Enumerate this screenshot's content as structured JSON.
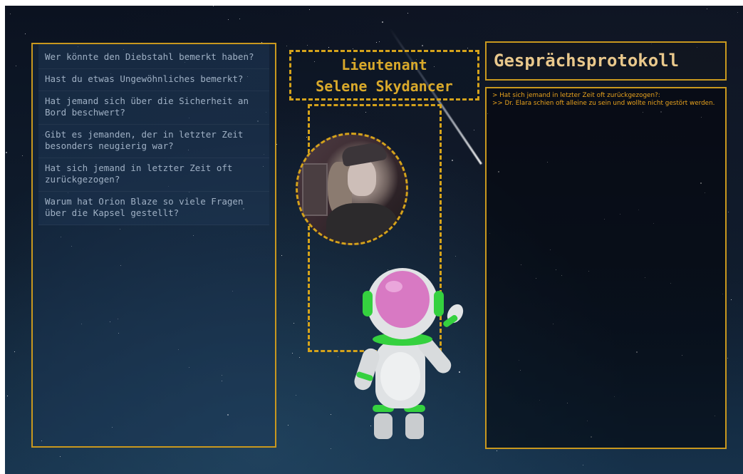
{
  "questions": [
    "Wer könnte den Diebstahl bemerkt haben?",
    "Hast du etwas Ungewöhnliches bemerkt?",
    "Hat jemand sich über die Sicherheit an Bord beschwert?",
    "Gibt es jemanden, der in letzter Zeit besonders neugierig war?",
    "Hat sich jemand in letzter Zeit oft zurückgezogen?",
    "Warum hat Orion Blaze so viele Fragen über die Kapsel gestellt?"
  ],
  "character": {
    "line1": "Lieutenant",
    "line2": "Selene Skydancer"
  },
  "log": {
    "title": "Gesprächsprotokoll",
    "entries": [
      "> Hat sich jemand in letzter Zeit oft zurückgezogen?:",
      ">> Dr. Elara schien oft alleine zu sein und wollte nicht gestört werden."
    ]
  },
  "colors": {
    "accent": "#c9981e",
    "log_text": "#e8a21d",
    "question_text": "#9fb0c4",
    "name_text": "#d9a92b"
  }
}
